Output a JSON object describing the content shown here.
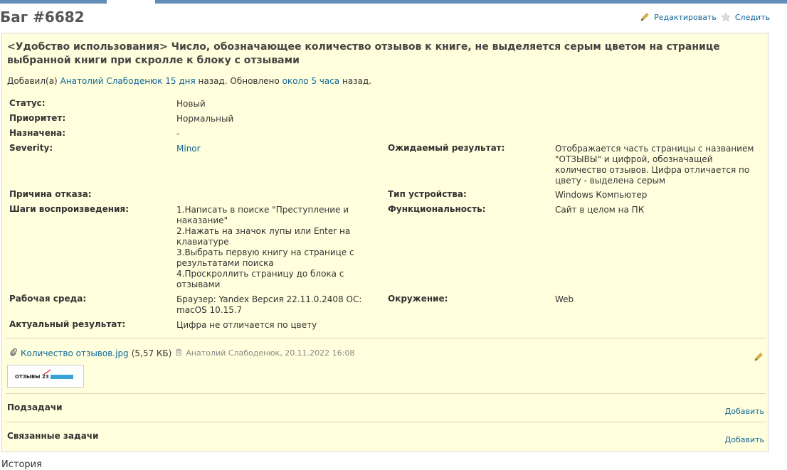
{
  "header": {
    "title": "Баг #6682",
    "edit_label": "Редактировать",
    "watch_label": "Следить"
  },
  "issue": {
    "subject": "<Удобство использования> Число, обозначающее количество отзывов к книге, не выделяется серым цветом на странице выбранной книги при скролле к блоку с отзывами",
    "author_prefix": "Добавил(а)",
    "author": "Анатолий Слабоденюк",
    "created": "15 дня",
    "created_suffix": "назад. Обновлено",
    "updated": "около 5 часа",
    "updated_suffix": "назад."
  },
  "attributes": {
    "status_label": "Статус:",
    "status": "Новый",
    "priority_label": "Приоритет:",
    "priority": "Нормальный",
    "assigned_label": "Назначена:",
    "assigned": "-",
    "severity_label": "Severity:",
    "severity": "Minor",
    "expected_label": "Ожидаемый результат:",
    "expected": "Отображается часть страницы с названием \"ОТЗЫВЫ\" и цифрой, обозначащей количество отзывов. Цифра отличается по цвету - выделена серым",
    "reject_label": "Причина отказа:",
    "reject": "",
    "device_label": "Тип устройства:",
    "device": "Windows Компьютер",
    "steps_label": "Шаги воспроизведения:",
    "steps": [
      "1.Написать в поиске \"Преступление и наказание\"",
      "2.Нажать на значок лупы или Enter на клавиатуре",
      "3.Выбрать первую книгу на странице с результатами поиска",
      "4.Проскроллить страницу до блока с отзывами"
    ],
    "functionality_label": "Функциональность:",
    "functionality": "Сайт в целом на ПК",
    "env_label": "Рабочая среда:",
    "env": "Браузер: Yandex Версия 22.11.0.2408 OC: macOS 10.15.7",
    "environment_label": "Окружение:",
    "environment": "Web",
    "actual_label": "Актуальный результат:",
    "actual": "Цифра не отличается по цвету"
  },
  "attachment": {
    "filename": "Количество отзывов.jpg",
    "size": "(5,57 КБ)",
    "meta": "Анатолий Слабоденюк, 20.11.2022 16:08",
    "thumb_text": "ОТЗЫВЫ 23"
  },
  "subtasks": {
    "title": "Подзадачи",
    "add_label": "Добавить"
  },
  "relations": {
    "title": "Связанные задачи",
    "add_label": "Добавить"
  },
  "history": {
    "title": "История"
  }
}
